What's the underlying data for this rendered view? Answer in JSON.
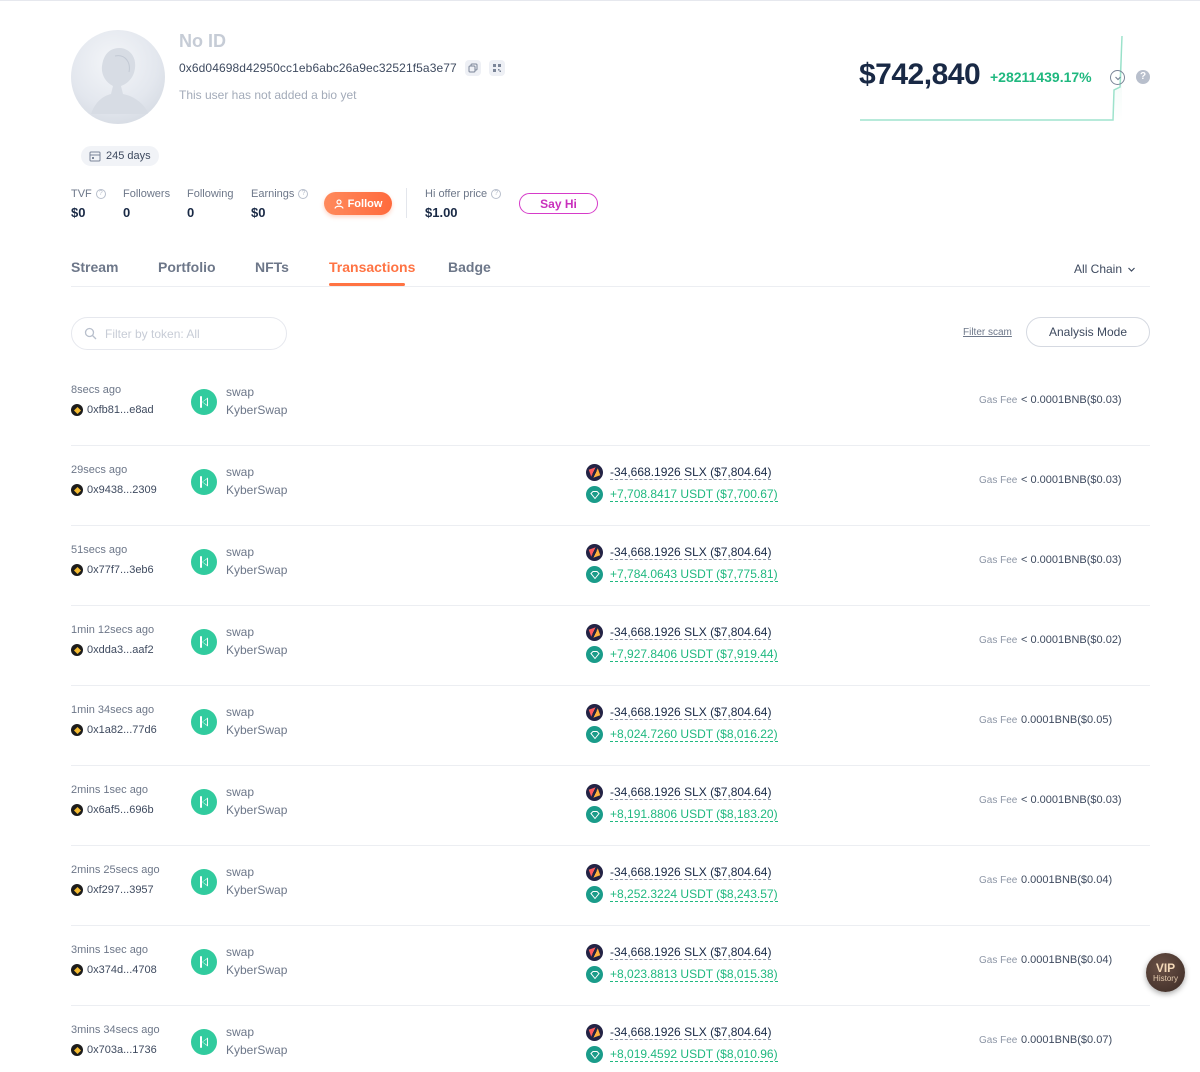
{
  "profile": {
    "name": "No ID",
    "address": "0x6d04698d42950cc1eb6abc26a9ec32521f5a3e77",
    "bio": "This user has not added a bio yet",
    "days": "245 days"
  },
  "stats": {
    "tvf_label": "TVF",
    "tvf_value": "$0",
    "followers_label": "Followers",
    "followers_value": "0",
    "following_label": "Following",
    "following_value": "0",
    "earnings_label": "Earnings",
    "earnings_value": "$0",
    "follow_label": "Follow",
    "hi_offer_label": "Hi offer price",
    "hi_offer_value": "$1.00",
    "sayhi_label": "Say Hi"
  },
  "net": {
    "value": "$742,840",
    "change": "+28211439.17%",
    "accent_color": "#1fb87f"
  },
  "tabs": [
    {
      "label": "Stream"
    },
    {
      "label": "Portfolio"
    },
    {
      "label": "NFTs"
    },
    {
      "label": "Transactions"
    },
    {
      "label": "Badge"
    }
  ],
  "active_tab": "Transactions",
  "chain_filter": "All Chain",
  "filter": {
    "placeholder": "Filter by token: All",
    "scam_label": "Filter scam",
    "analysis_label": "Analysis Mode"
  },
  "transactions": [
    {
      "time": "8secs ago",
      "hash": "0xfb81...e8ad",
      "type": "swap",
      "protocol": "KyberSwap",
      "out": "",
      "in": "",
      "gas_label": "Gas Fee",
      "gas": "< 0.0001BNB($0.03)"
    },
    {
      "time": "29secs ago",
      "hash": "0x9438...2309",
      "type": "swap",
      "protocol": "KyberSwap",
      "out": "-34,668.1926 SLX ($7,804.64)",
      "in": "+7,708.8417 USDT ($7,700.67)",
      "gas_label": "Gas Fee",
      "gas": "< 0.0001BNB($0.03)"
    },
    {
      "time": "51secs ago",
      "hash": "0x77f7...3eb6",
      "type": "swap",
      "protocol": "KyberSwap",
      "out": "-34,668.1926 SLX ($7,804.64)",
      "in": "+7,784.0643 USDT ($7,775.81)",
      "gas_label": "Gas Fee",
      "gas": "< 0.0001BNB($0.03)"
    },
    {
      "time": "1min 12secs ago",
      "hash": "0xdda3...aaf2",
      "type": "swap",
      "protocol": "KyberSwap",
      "out": "-34,668.1926 SLX ($7,804.64)",
      "in": "+7,927.8406 USDT ($7,919.44)",
      "gas_label": "Gas Fee",
      "gas": "< 0.0001BNB($0.02)"
    },
    {
      "time": "1min 34secs ago",
      "hash": "0x1a82...77d6",
      "type": "swap",
      "protocol": "KyberSwap",
      "out": "-34,668.1926 SLX ($7,804.64)",
      "in": "+8,024.7260 USDT ($8,016.22)",
      "gas_label": "Gas Fee",
      "gas": "0.0001BNB($0.05)"
    },
    {
      "time": "2mins 1sec ago",
      "hash": "0x6af5...696b",
      "type": "swap",
      "protocol": "KyberSwap",
      "out": "-34,668.1926 SLX ($7,804.64)",
      "in": "+8,191.8806 USDT ($8,183.20)",
      "gas_label": "Gas Fee",
      "gas": "< 0.0001BNB($0.03)"
    },
    {
      "time": "2mins 25secs ago",
      "hash": "0xf297...3957",
      "type": "swap",
      "protocol": "KyberSwap",
      "out": "-34,668.1926 SLX ($7,804.64)",
      "in": "+8,252.3224 USDT ($8,243.57)",
      "gas_label": "Gas Fee",
      "gas": "0.0001BNB($0.04)"
    },
    {
      "time": "3mins 1sec ago",
      "hash": "0x374d...4708",
      "type": "swap",
      "protocol": "KyberSwap",
      "out": "-34,668.1926 SLX ($7,804.64)",
      "in": "+8,023.8813 USDT ($8,015.38)",
      "gas_label": "Gas Fee",
      "gas": "0.0001BNB($0.04)"
    },
    {
      "time": "3mins 34secs ago",
      "hash": "0x703a...1736",
      "type": "swap",
      "protocol": "KyberSwap",
      "out": "-34,668.1926 SLX ($7,804.64)",
      "in": "+8,019.4592 USDT ($8,010.96)",
      "gas_label": "Gas Fee",
      "gas": "0.0001BNB($0.07)"
    }
  ],
  "vip": {
    "title": "VIP",
    "subtitle": "History"
  }
}
